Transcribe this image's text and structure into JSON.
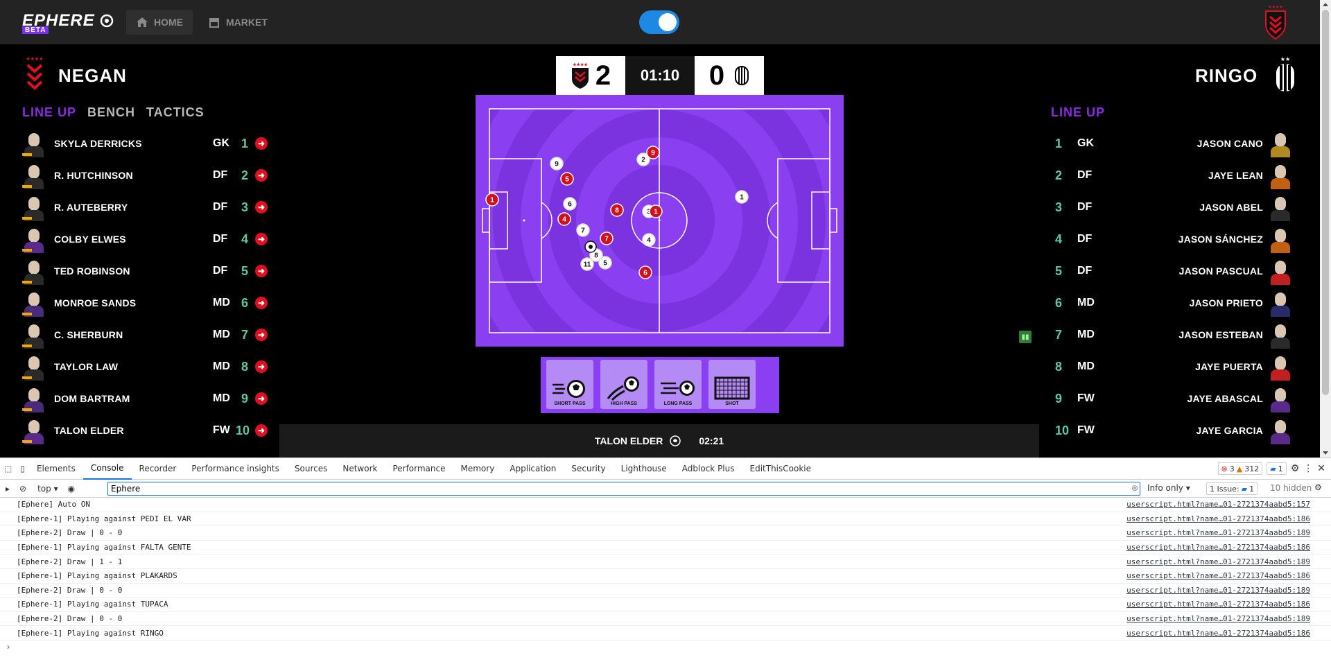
{
  "app": {
    "logo": "EPHERE",
    "logo_badge": "BETA",
    "nav": [
      {
        "label": "HOME",
        "icon": "home-icon"
      },
      {
        "label": "MARKET",
        "icon": "store-icon"
      }
    ],
    "toggle_on": true
  },
  "match": {
    "home_team": "NEGAN",
    "away_team": "RINGO",
    "home_score": "2",
    "time": "01:10",
    "away_score": "0",
    "tabs_home": [
      "LINE UP",
      "BENCH",
      "TACTICS"
    ],
    "tab_away": "LINE UP",
    "home_lineup": [
      {
        "name": "SKYLA DERRICKS",
        "pos": "GK",
        "num": "1"
      },
      {
        "name": "R. HUTCHINSON",
        "pos": "DF",
        "num": "2"
      },
      {
        "name": "R. AUTEBERRY",
        "pos": "DF",
        "num": "3"
      },
      {
        "name": "COLBY ELWES",
        "pos": "DF",
        "num": "4"
      },
      {
        "name": "TED ROBINSON",
        "pos": "DF",
        "num": "5"
      },
      {
        "name": "MONROE SANDS",
        "pos": "MD",
        "num": "6"
      },
      {
        "name": "C. SHERBURN",
        "pos": "MD",
        "num": "7"
      },
      {
        "name": "TAYLOR LAW",
        "pos": "MD",
        "num": "8"
      },
      {
        "name": "DOM BARTRAM",
        "pos": "MD",
        "num": "9"
      },
      {
        "name": "TALON ELDER",
        "pos": "FW",
        "num": "10"
      }
    ],
    "away_lineup": [
      {
        "name": "JASON CANO",
        "pos": "GK",
        "num": "1"
      },
      {
        "name": "JAYE LEAN",
        "pos": "DF",
        "num": "2"
      },
      {
        "name": "JASON ABEL",
        "pos": "DF",
        "num": "3"
      },
      {
        "name": "JASON SÁNCHEZ",
        "pos": "DF",
        "num": "4"
      },
      {
        "name": "JASON PASCUAL",
        "pos": "DF",
        "num": "5"
      },
      {
        "name": "JASON PRIETO",
        "pos": "MD",
        "num": "6"
      },
      {
        "name": "JASON ESTEBAN",
        "pos": "MD",
        "num": "7"
      },
      {
        "name": "JAYE PUERTA",
        "pos": "MD",
        "num": "8"
      },
      {
        "name": "JAYE ABASCAL",
        "pos": "FW",
        "num": "9"
      },
      {
        "name": "JAYE GARCIA",
        "pos": "FW",
        "num": "10"
      }
    ],
    "pitch_red_tokens": [
      "1",
      "5",
      "4",
      "7",
      "8",
      "9",
      "6",
      "1"
    ],
    "pitch_white_tokens": [
      "9",
      "6",
      "7",
      "8",
      "11",
      "5",
      "2",
      "3",
      "4",
      "1"
    ],
    "actions": [
      "SHORT PASS",
      "HIGH PASS",
      "LONG PASS",
      "SHOT"
    ],
    "event_player": "TALON ELDER",
    "event_time": "02:21"
  },
  "devtools": {
    "tabs": [
      "Elements",
      "Console",
      "Recorder",
      "Performance insights",
      "Sources",
      "Network",
      "Performance",
      "Memory",
      "Application",
      "Security",
      "Lighthouse",
      "Adblock Plus",
      "EditThisCookie"
    ],
    "active_tab": "Console",
    "errors": "3",
    "warnings": "312",
    "messages": "1",
    "context": "top",
    "filter_value": "Ephere",
    "level": "Info only",
    "issues": "1 Issue:",
    "issues_count": "1",
    "hidden": "10 hidden",
    "logs": [
      {
        "text": "[Ephere] Auto ON",
        "src": "userscript.html?name…01-2721374aabd5:157"
      },
      {
        "text": "[Ephere-1] Playing against PEDI EL VAR",
        "src": "userscript.html?name…01-2721374aabd5:186"
      },
      {
        "text": "[Ephere-2] Draw | 0 - 0",
        "src": "userscript.html?name…01-2721374aabd5:189"
      },
      {
        "text": "[Ephere-1] Playing against FALTA GENTE",
        "src": "userscript.html?name…01-2721374aabd5:186"
      },
      {
        "text": "[Ephere-2] Draw | 1 - 1",
        "src": "userscript.html?name…01-2721374aabd5:189"
      },
      {
        "text": "[Ephere-1] Playing against PLAKARDS",
        "src": "userscript.html?name…01-2721374aabd5:186"
      },
      {
        "text": "[Ephere-2] Draw | 0 - 0",
        "src": "userscript.html?name…01-2721374aabd5:189"
      },
      {
        "text": "[Ephere-1] Playing against TUPACA",
        "src": "userscript.html?name…01-2721374aabd5:186"
      },
      {
        "text": "[Ephere-2] Draw | 0 - 0",
        "src": "userscript.html?name…01-2721374aabd5:189"
      },
      {
        "text": "[Ephere-1] Playing against RINGO",
        "src": "userscript.html?name…01-2721374aabd5:186"
      }
    ]
  },
  "colors": {
    "accent": "#8a2be2",
    "pitch": "#8a3ff0",
    "red": "#e0101e",
    "number": "#5fc7a9"
  }
}
